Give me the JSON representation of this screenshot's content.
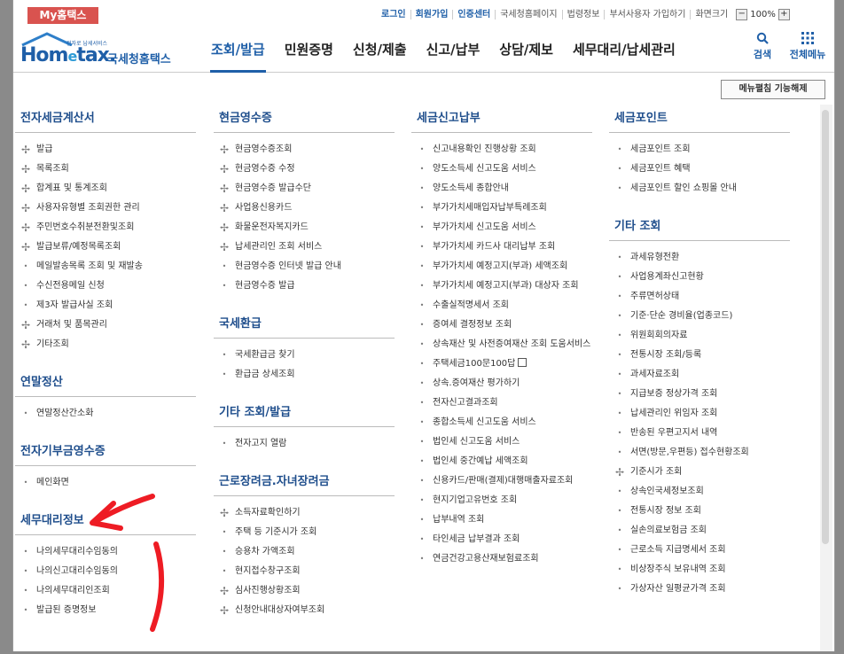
{
  "top": {
    "my_badge": "My홈택스",
    "links_blue": [
      "로그인",
      "회원가입",
      "인증센터"
    ],
    "links": [
      "국세청홈페이지",
      "법령정보",
      "부서사용자 가입하기",
      "화면크기"
    ],
    "zoom_minus": "−",
    "zoom_value": "100%",
    "zoom_plus": "+"
  },
  "header": {
    "logo_tagline": "전자로 납세서비스",
    "logo_brand_a": "Hom",
    "logo_brand_e": "e",
    "logo_brand_b": "tax.",
    "logo_sub": "국세청홈택스",
    "nav": [
      "조회/발급",
      "민원증명",
      "신청/제출",
      "신고/납부",
      "상담/제보",
      "세무대리/납세관리"
    ],
    "active_index": 0,
    "search_label": "검색",
    "allmenu_label": "전체메뉴",
    "accent": "#1f5fa8"
  },
  "menu_fix_label": "메뉴펼침 기능해제",
  "columns": [
    {
      "sections": [
        {
          "title": "전자세금계산서",
          "items": [
            {
              "t": "발급",
              "m": "plus"
            },
            {
              "t": "목록조회",
              "m": "plus"
            },
            {
              "t": "합계표 및 통계조회",
              "m": "plus"
            },
            {
              "t": "사용자유형별 조회권한 관리",
              "m": "plus"
            },
            {
              "t": "주민번호수취분전환및조회",
              "m": "plus"
            },
            {
              "t": "발급보류/예정목록조회",
              "m": "plus"
            },
            {
              "t": "메일발송목록 조회 및 재발송",
              "m": "dot"
            },
            {
              "t": "수신전용메일 신청",
              "m": "dot"
            },
            {
              "t": "제3자 발급사실 조회",
              "m": "dot"
            },
            {
              "t": "거래처 및 품목관리",
              "m": "plus"
            },
            {
              "t": "기타조회",
              "m": "plus"
            }
          ]
        },
        {
          "title": "연말정산",
          "items": [
            {
              "t": "연말정산간소화",
              "m": "dot"
            }
          ]
        },
        {
          "title": "전자기부금영수증",
          "items": [
            {
              "t": "메인화면",
              "m": "dot"
            }
          ]
        },
        {
          "title": "세무대리정보",
          "items": [
            {
              "t": "나의세무대리수임동의",
              "m": "dot"
            },
            {
              "t": "나의신고대리수임동의",
              "m": "dot"
            },
            {
              "t": "나의세무대리인조회",
              "m": "dot"
            },
            {
              "t": "발급된 증명정보",
              "m": "dot"
            }
          ]
        }
      ]
    },
    {
      "sections": [
        {
          "title": "현금영수증",
          "items": [
            {
              "t": "현금영수증조회",
              "m": "plus"
            },
            {
              "t": "현금영수증 수정",
              "m": "plus"
            },
            {
              "t": "현금영수증 발급수단",
              "m": "plus"
            },
            {
              "t": "사업용신용카드",
              "m": "plus"
            },
            {
              "t": "화물운전자복지카드",
              "m": "plus"
            },
            {
              "t": "납세관리인 조회 서비스",
              "m": "plus"
            },
            {
              "t": "현금영수증 인터넷 발급 안내",
              "m": "dot"
            },
            {
              "t": "현금영수증 발급",
              "m": "dot"
            }
          ]
        },
        {
          "title": "국세환급",
          "items": [
            {
              "t": "국세환급금 찾기",
              "m": "dot"
            },
            {
              "t": "환급금 상세조회",
              "m": "dot"
            }
          ]
        },
        {
          "title": "기타 조회/발급",
          "items": [
            {
              "t": "전자고지 열람",
              "m": "dot"
            }
          ]
        },
        {
          "title": "근로장려금.자녀장려금",
          "items": [
            {
              "t": "소득자료확인하기",
              "m": "plus"
            },
            {
              "t": "주택 등 기준시가 조회",
              "m": "dot"
            },
            {
              "t": "승용차 가액조회",
              "m": "dot"
            },
            {
              "t": "현지접수창구조회",
              "m": "dot"
            },
            {
              "t": "심사진행상황조회",
              "m": "plus"
            },
            {
              "t": "신청안내대상자여부조회",
              "m": "plus"
            }
          ]
        }
      ]
    },
    {
      "sections": [
        {
          "title": "세금신고납부",
          "items": [
            {
              "t": "신고내용확인 진행상황 조회",
              "m": "dot"
            },
            {
              "t": "양도소득세 신고도움 서비스",
              "m": "dot"
            },
            {
              "t": "양도소득세 종합안내",
              "m": "dot"
            },
            {
              "t": "부가가치세매입자납부특례조회",
              "m": "dot"
            },
            {
              "t": "부가가치세 신고도움 서비스",
              "m": "dot"
            },
            {
              "t": "부가가치세 카드사 대리납부 조회",
              "m": "dot"
            },
            {
              "t": "부가가치세 예정고지(부과) 세액조회",
              "m": "dot"
            },
            {
              "t": "부가가치세 예정고지(부과) 대상자 조회",
              "m": "dot"
            },
            {
              "t": "수출실적명세서 조회",
              "m": "dot"
            },
            {
              "t": "증여세 결정정보 조회",
              "m": "dot"
            },
            {
              "t": "상속재산 및 사전증여재산 조회 도움서비스",
              "m": "dot"
            },
            {
              "t": "주택세금100문100답",
              "m": "dot",
              "ext": true
            },
            {
              "t": "상속.증여재산 평가하기",
              "m": "dot"
            },
            {
              "t": "전자신고결과조회",
              "m": "dot"
            },
            {
              "t": "종합소득세 신고도움 서비스",
              "m": "dot"
            },
            {
              "t": "법인세 신고도움 서비스",
              "m": "dot"
            },
            {
              "t": "법인세 중간예납 세액조회",
              "m": "dot"
            },
            {
              "t": "신용카드/판매(결제)대행매출자료조회",
              "m": "dot"
            },
            {
              "t": "현지기업고유번호 조회",
              "m": "dot"
            },
            {
              "t": "납부내역 조회",
              "m": "dot"
            },
            {
              "t": "타인세금 납부결과 조회",
              "m": "dot"
            },
            {
              "t": "연금건강고용산재보험료조회",
              "m": "dot"
            }
          ]
        }
      ]
    },
    {
      "sections": [
        {
          "title": "세금포인트",
          "items": [
            {
              "t": "세금포인트 조회",
              "m": "dot"
            },
            {
              "t": "세금포인트 혜택",
              "m": "dot"
            },
            {
              "t": "세금포인트 할인 쇼핑몰 안내",
              "m": "dot"
            }
          ]
        },
        {
          "title": "기타 조회",
          "items": [
            {
              "t": "과세유형전환",
              "m": "dot"
            },
            {
              "t": "사업용계좌신고현황",
              "m": "dot"
            },
            {
              "t": "주류면허상태",
              "m": "dot"
            },
            {
              "t": "기준·단순 경비율(업종코드)",
              "m": "dot"
            },
            {
              "t": "위원회회의자료",
              "m": "dot"
            },
            {
              "t": "전통시장 조회/등록",
              "m": "dot"
            },
            {
              "t": "과세자료조회",
              "m": "dot"
            },
            {
              "t": "지급보증 정상가격 조회",
              "m": "dot"
            },
            {
              "t": "납세관리인 위임자 조회",
              "m": "dot"
            },
            {
              "t": "반송된 우편고지서 내역",
              "m": "dot"
            },
            {
              "t": "서면(방문,우편등) 접수현황조회",
              "m": "dot"
            },
            {
              "t": "기준시가 조회",
              "m": "plus"
            },
            {
              "t": "상속인국세정보조회",
              "m": "dot"
            },
            {
              "t": "전통시장 정보 조회",
              "m": "dot"
            },
            {
              "t": "실손의료보험금 조회",
              "m": "dot"
            },
            {
              "t": "근로소득 지급명세서 조회",
              "m": "dot"
            },
            {
              "t": "비상장주식 보유내역 조회",
              "m": "dot"
            },
            {
              "t": "가상자산 일평균가격 조회",
              "m": "dot"
            }
          ]
        }
      ]
    }
  ],
  "annotation_color": "#ee1c24"
}
